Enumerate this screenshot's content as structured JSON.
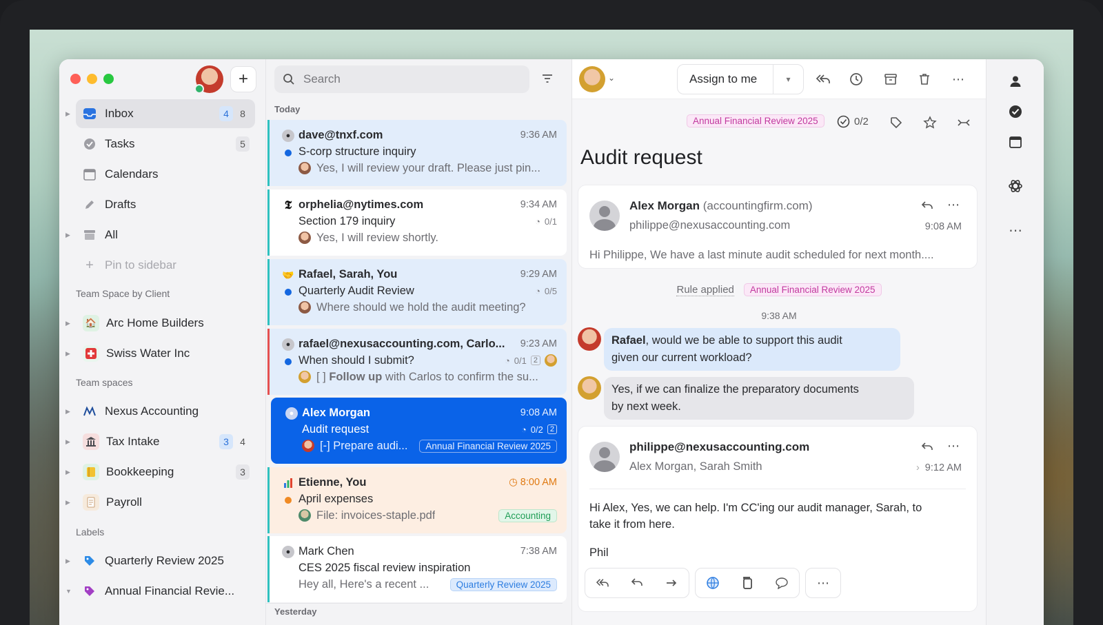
{
  "sidebar": {
    "inbox": {
      "label": "Inbox",
      "count_unread": "4",
      "count_total": "8"
    },
    "tasks": {
      "label": "Tasks",
      "count": "5"
    },
    "calendars": {
      "label": "Calendars"
    },
    "drafts": {
      "label": "Drafts"
    },
    "all": {
      "label": "All"
    },
    "pin": {
      "label": "Pin to sidebar"
    },
    "team_space_by_client": {
      "title": "Team Space by Client",
      "items": [
        {
          "label": "Arc Home Builders"
        },
        {
          "label": "Swiss Water Inc"
        }
      ]
    },
    "team_spaces": {
      "title": "Team spaces",
      "items": [
        {
          "label": "Nexus Accounting"
        },
        {
          "label": "Tax Intake",
          "count_unread": "3",
          "count_total": "4"
        },
        {
          "label": "Bookkeeping",
          "count": "3"
        },
        {
          "label": "Payroll"
        }
      ]
    },
    "labels": {
      "title": "Labels",
      "items": [
        {
          "label": "Quarterly Review 2025"
        },
        {
          "label": "Annual Financial Revie..."
        }
      ]
    }
  },
  "list": {
    "search_placeholder": "Search",
    "today": "Today",
    "yesterday": "Yesterday",
    "threads": [
      {
        "from": "dave@tnxf.com",
        "time": "9:36 AM",
        "subject": "S-corp structure inquiry",
        "snippet": "Yes, I will review your draft. Please just pin..."
      },
      {
        "from": "orphelia@nytimes.com",
        "time": "9:34 AM",
        "subject": "Section 179 inquiry",
        "tasks": "0/1",
        "snippet": "Yes, I will review shortly."
      },
      {
        "from": "Rafael, Sarah, You",
        "time": "9:29 AM",
        "subject": "Quarterly Audit Review",
        "tasks": "0/5",
        "snippet": "Where should we hold the audit meeting?"
      },
      {
        "from": "rafael@nexusaccounting.com, Carlo...",
        "time": "9:23 AM",
        "subject": "When should I submit?",
        "tasks": "0/1",
        "replies": "2",
        "snippet_prefix": "[ ] ",
        "snippet_bold": "Follow up",
        "snippet": " with Carlos to confirm the su..."
      },
      {
        "from": "Alex Morgan",
        "time": "9:08 AM",
        "subject": "Audit request",
        "tasks": "0/2",
        "replies": "2",
        "snippet": "[-] Prepare audi...",
        "tag": "Annual Financial Review 2025"
      },
      {
        "from": "Etienne, You",
        "time": "8:00 AM",
        "subject": "April expenses",
        "snippet": "File: invoices-staple.pdf",
        "tag": "Accounting"
      },
      {
        "from": "Mark Chen",
        "time": "7:38 AM",
        "subject": "CES 2025 fiscal review inspiration",
        "snippet": "Hey all, Here's a recent ...",
        "tag": "Quarterly Review 2025"
      }
    ]
  },
  "reader": {
    "assign_label": "Assign to me",
    "label_tag": "Annual Financial Review 2025",
    "tasks": "0/2",
    "subject": "Audit request",
    "message1": {
      "sender": "Alex Morgan",
      "domain": "(accountingfirm.com)",
      "to": "philippe@nexusaccounting.com",
      "time": "9:08 AM",
      "preview": "Hi Philippe, We have a last minute audit scheduled for next month...."
    },
    "rule": {
      "text": "Rule applied",
      "tag": "Annual Financial Review 2025"
    },
    "chat_time": "9:38 AM",
    "chat": [
      {
        "name": "Rafael",
        "text": ", would we be able to support this audit",
        "text2": "given our current workload?"
      },
      {
        "text": "Yes, if we can finalize the preparatory documents",
        "text2": "by next week."
      }
    ],
    "message2": {
      "sender": "philippe@nexusaccounting.com",
      "to": "Alex Morgan, Sarah Smith",
      "time": "9:12 AM",
      "body1": "Hi Alex, Yes, we can help. I'm CC'ing our audit manager, Sarah, to",
      "body2": "take it from here.",
      "signoff": "Phil"
    }
  },
  "colors": {
    "accent": "#0a63e8",
    "teal_edge": "#2fc1bf",
    "label_pink": "#c2399f"
  }
}
